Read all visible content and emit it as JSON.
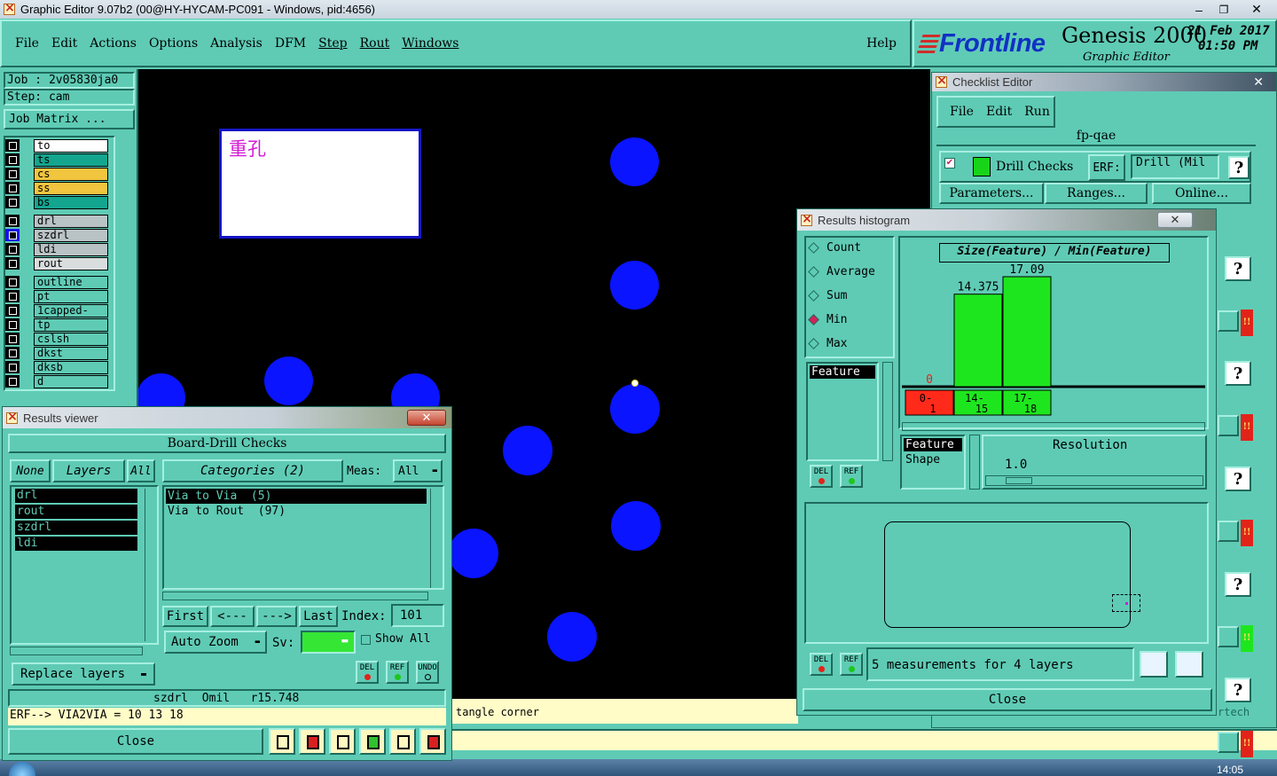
{
  "window": {
    "title": "Graphic Editor 9.07b2 (00@HY-HYCAM-PC091 - Windows, pid:4656)",
    "controls": [
      "–",
      "❐",
      "✕"
    ]
  },
  "menu": {
    "items": [
      "File",
      "Edit",
      "Actions",
      "Options",
      "Analysis",
      "DFM",
      "Step",
      "Rout",
      "Windows"
    ],
    "help": "Help"
  },
  "brand": {
    "logo": "Frontline",
    "product": "Genesis 2000",
    "subtitle": "Graphic Editor",
    "date": "21 Feb 2017",
    "time": "01:50 PM"
  },
  "job": {
    "job_label": "Job : 2v05830ja0",
    "step_label": "Step: cam",
    "matrix_button": "Job Matrix ..."
  },
  "layers": [
    {
      "name": "to",
      "color": "#ffffff",
      "fg": "#000000",
      "selected": false
    },
    {
      "name": "ts",
      "color": "#14a58f",
      "fg": "#000000",
      "selected": false
    },
    {
      "name": "cs",
      "color": "#f2c53f",
      "fg": "#000000",
      "selected": false
    },
    {
      "name": "ss",
      "color": "#f2c53f",
      "fg": "#000000",
      "selected": false
    },
    {
      "name": "bs",
      "color": "#14a58f",
      "fg": "#000000",
      "selected": false
    },
    {
      "name": "drl",
      "color": "#b9c2c4",
      "fg": "#000000",
      "selected": false
    },
    {
      "name": "szdrl",
      "color": "#b9c2c4",
      "fg": "#000000",
      "selected": true
    },
    {
      "name": "ldi",
      "color": "#b9c2c4",
      "fg": "#000000",
      "selected": false
    },
    {
      "name": "rout",
      "color": "#d9dddd",
      "fg": "#000000",
      "selected": false
    },
    {
      "name": "outline",
      "color": "#5fcbb5",
      "fg": "#000000",
      "selected": false
    },
    {
      "name": "pt",
      "color": "#5fcbb5",
      "fg": "#000000",
      "selected": false
    },
    {
      "name": "1capped-via",
      "color": "#5fcbb5",
      "fg": "#000000",
      "selected": false
    },
    {
      "name": "tp",
      "color": "#5fcbb5",
      "fg": "#000000",
      "selected": false
    },
    {
      "name": "cslsh",
      "color": "#5fcbb5",
      "fg": "#000000",
      "selected": false
    },
    {
      "name": "dkst",
      "color": "#5fcbb5",
      "fg": "#000000",
      "selected": false
    },
    {
      "name": "dksb",
      "color": "#5fcbb5",
      "fg": "#000000",
      "selected": false
    },
    {
      "name": "d",
      "color": "#5fcbb5",
      "fg": "#000000",
      "selected": false
    }
  ],
  "canvas": {
    "note_text": "重孔",
    "status_text": "tangle corner"
  },
  "checklist": {
    "title": "Checklist Editor",
    "menu": [
      "File",
      "Edit",
      "Run"
    ],
    "name": "fp-qae",
    "check_name": "Drill Checks",
    "erf_label": "ERF:",
    "erf_value": "Drill (Mil",
    "help": "?",
    "buttons": [
      "Parameters...",
      "Ranges...",
      "Online..."
    ],
    "strip_marker": "!!",
    "strip_bottom": "rtech"
  },
  "results_viewer": {
    "title": "Results viewer",
    "header": "Board-Drill Checks",
    "layer_tabs": {
      "none": "None",
      "layers": "Layers",
      "all": "All"
    },
    "categories_label": "Categories (2)",
    "meas_label": "Meas:",
    "meas_value": "All",
    "layer_list": [
      "drl",
      "rout",
      "szdrl",
      "ldi"
    ],
    "categories": [
      "Via to Via  (5)",
      "Via to Rout  (97)"
    ],
    "nav": {
      "first": "First",
      "prev": "<---",
      "next": "--->",
      "last": "Last",
      "index_label": "Index:",
      "index_value": "101"
    },
    "auto_zoom": "Auto Zoom",
    "sv_label": "Sv:",
    "show_all": "Show All",
    "replace_layers": "Replace layers",
    "small_buttons": [
      "DEL",
      "REF",
      "UNDO"
    ],
    "info_line": "szdrl  Omil   r15.748",
    "erf_line": "ERF--> VIA2VIA = 10 13 18",
    "close": "Close"
  },
  "histogram": {
    "title": "Results histogram",
    "modes": [
      {
        "label": "Count",
        "selected": false
      },
      {
        "label": "Average",
        "selected": false
      },
      {
        "label": "Sum",
        "selected": false
      },
      {
        "label": "Min",
        "selected": true
      },
      {
        "label": "Max",
        "selected": false
      }
    ],
    "feature_list": [
      "Feature"
    ],
    "small_buttons": [
      "DEL",
      "REF"
    ],
    "feature_shape": [
      "Feature",
      "Shape"
    ],
    "resolution_label": "Resolution",
    "resolution_value": "1.0",
    "measurements": "5 measurements for 4 layers",
    "close": "Close"
  },
  "chart_data": {
    "type": "bar",
    "title": "Size(Feature) / Min(Feature)",
    "categories": [
      "0-\n1",
      "14-\n15",
      "17-\n18"
    ],
    "category_colors": [
      "#ff2a1a",
      "#1ee61e",
      "#1ee61e"
    ],
    "values": [
      0,
      14.375,
      17.09
    ],
    "value_labels": [
      "0",
      "14.375",
      "17.09"
    ],
    "ylim": [
      0,
      17.09
    ]
  },
  "taskbar": {
    "clock": "14:05"
  }
}
